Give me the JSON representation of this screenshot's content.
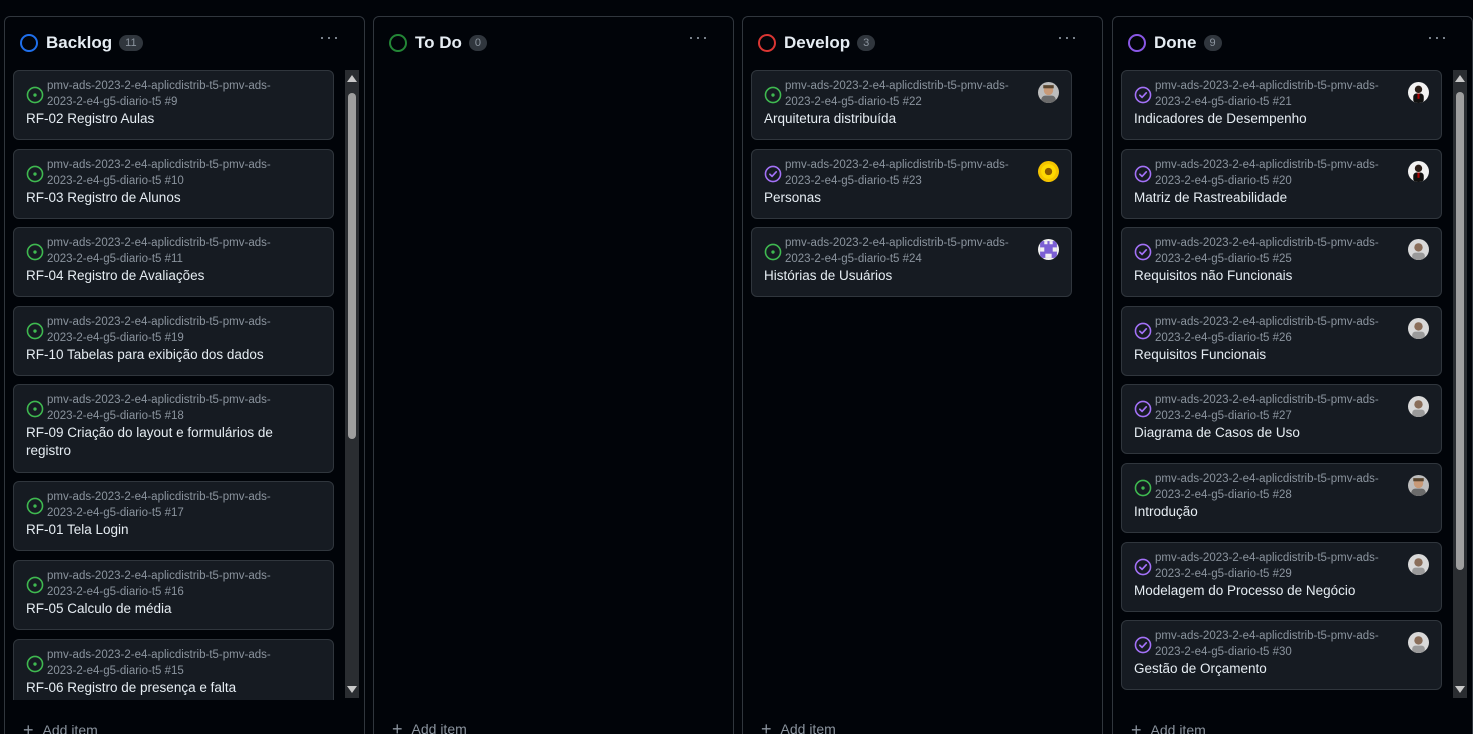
{
  "columns": [
    {
      "title": "Backlog",
      "count": "11",
      "status_color": "#1f6feb",
      "menu": "···",
      "add_item": "Add item",
      "cards": [
        {
          "repo": "pmv-ads-2023-2-e4-aplicdistrib-t5-pmv-ads-2023-2-e4-g5-diario-t5 #9",
          "title": "RF-02 Registro Aulas",
          "icon": "open-issue-icon",
          "avatar": null
        },
        {
          "repo": "pmv-ads-2023-2-e4-aplicdistrib-t5-pmv-ads-2023-2-e4-g5-diario-t5 #10",
          "title": "RF-03 Registro de Alunos",
          "icon": "open-issue-icon",
          "avatar": null
        },
        {
          "repo": "pmv-ads-2023-2-e4-aplicdistrib-t5-pmv-ads-2023-2-e4-g5-diario-t5 #11",
          "title": "RF-04 Registro de Avaliações",
          "icon": "open-issue-icon",
          "avatar": null
        },
        {
          "repo": "pmv-ads-2023-2-e4-aplicdistrib-t5-pmv-ads-2023-2-e4-g5-diario-t5 #19",
          "title": "RF-10 Tabelas para exibição dos dados",
          "icon": "open-issue-icon",
          "avatar": null
        },
        {
          "repo": "pmv-ads-2023-2-e4-aplicdistrib-t5-pmv-ads-2023-2-e4-g5-diario-t5 #18",
          "title": "RF-09 Criação do layout e formulários de registro",
          "icon": "open-issue-icon",
          "avatar": null
        },
        {
          "repo": "pmv-ads-2023-2-e4-aplicdistrib-t5-pmv-ads-2023-2-e4-g5-diario-t5 #17",
          "title": "RF-01 Tela Login",
          "icon": "open-issue-icon",
          "avatar": null
        },
        {
          "repo": "pmv-ads-2023-2-e4-aplicdistrib-t5-pmv-ads-2023-2-e4-g5-diario-t5 #16",
          "title": "RF-05 Calculo de média",
          "icon": "open-issue-icon",
          "avatar": null
        },
        {
          "repo": "pmv-ads-2023-2-e4-aplicdistrib-t5-pmv-ads-2023-2-e4-g5-diario-t5 #15",
          "title": "RF-06 Registro de presença e falta",
          "icon": "open-issue-icon",
          "avatar": null
        }
      ]
    },
    {
      "title": "To Do",
      "count": "0",
      "status_color": "#238636",
      "menu": "···",
      "add_item": "Add item",
      "cards": []
    },
    {
      "title": "Develop",
      "count": "3",
      "status_color": "#da3633",
      "menu": "···",
      "add_item": "Add item",
      "cards": [
        {
          "repo": "pmv-ads-2023-2-e4-aplicdistrib-t5-pmv-ads-2023-2-e4-g5-diario-t5 #22",
          "title": "Arquitetura distribuída",
          "icon": "open-issue-icon",
          "avatar": "photo-avatar"
        },
        {
          "repo": "pmv-ads-2023-2-e4-aplicdistrib-t5-pmv-ads-2023-2-e4-g5-diario-t5 #23",
          "title": "Personas",
          "icon": "closed-issue-icon",
          "avatar": "sunflower-avatar"
        },
        {
          "repo": "pmv-ads-2023-2-e4-aplicdistrib-t5-pmv-ads-2023-2-e4-g5-diario-t5 #24",
          "title": "Histórias de Usuários",
          "icon": "open-issue-icon",
          "avatar": "identicon-avatar"
        }
      ]
    },
    {
      "title": "Done",
      "count": "9",
      "status_color": "#8957e5",
      "menu": "···",
      "add_item": "Add item",
      "cards": [
        {
          "repo": "pmv-ads-2023-2-e4-aplicdistrib-t5-pmv-ads-2023-2-e4-g5-diario-t5 #21",
          "title": "Indicadores de Desempenho",
          "icon": "closed-issue-icon",
          "avatar": "dark-avatar"
        },
        {
          "repo": "pmv-ads-2023-2-e4-aplicdistrib-t5-pmv-ads-2023-2-e4-g5-diario-t5 #20",
          "title": "Matriz de Rastreabilidade",
          "icon": "closed-issue-icon",
          "avatar": "dark-avatar"
        },
        {
          "repo": "pmv-ads-2023-2-e4-aplicdistrib-t5-pmv-ads-2023-2-e4-g5-diario-t5 #25",
          "title": "Requisitos não Funcionais",
          "icon": "closed-issue-icon",
          "avatar": "light-avatar"
        },
        {
          "repo": "pmv-ads-2023-2-e4-aplicdistrib-t5-pmv-ads-2023-2-e4-g5-diario-t5 #26",
          "title": "Requisitos Funcionais",
          "icon": "closed-issue-icon",
          "avatar": "light-avatar"
        },
        {
          "repo": "pmv-ads-2023-2-e4-aplicdistrib-t5-pmv-ads-2023-2-e4-g5-diario-t5 #27",
          "title": "Diagrama de Casos de Uso",
          "icon": "closed-issue-icon",
          "avatar": "light-avatar"
        },
        {
          "repo": "pmv-ads-2023-2-e4-aplicdistrib-t5-pmv-ads-2023-2-e4-g5-diario-t5 #28",
          "title": "Introdução",
          "icon": "open-issue-icon",
          "avatar": "photo-avatar"
        },
        {
          "repo": "pmv-ads-2023-2-e4-aplicdistrib-t5-pmv-ads-2023-2-e4-g5-diario-t5 #29",
          "title": "Modelagem do Processo de Negócio",
          "icon": "closed-issue-icon",
          "avatar": "light-avatar"
        },
        {
          "repo": "pmv-ads-2023-2-e4-aplicdistrib-t5-pmv-ads-2023-2-e4-g5-diario-t5 #30",
          "title": "Gestão de Orçamento",
          "icon": "closed-issue-icon",
          "avatar": "light-avatar"
        }
      ]
    }
  ],
  "colors": {
    "open_issue": "#3fb950",
    "closed_issue": "#a371f7"
  }
}
